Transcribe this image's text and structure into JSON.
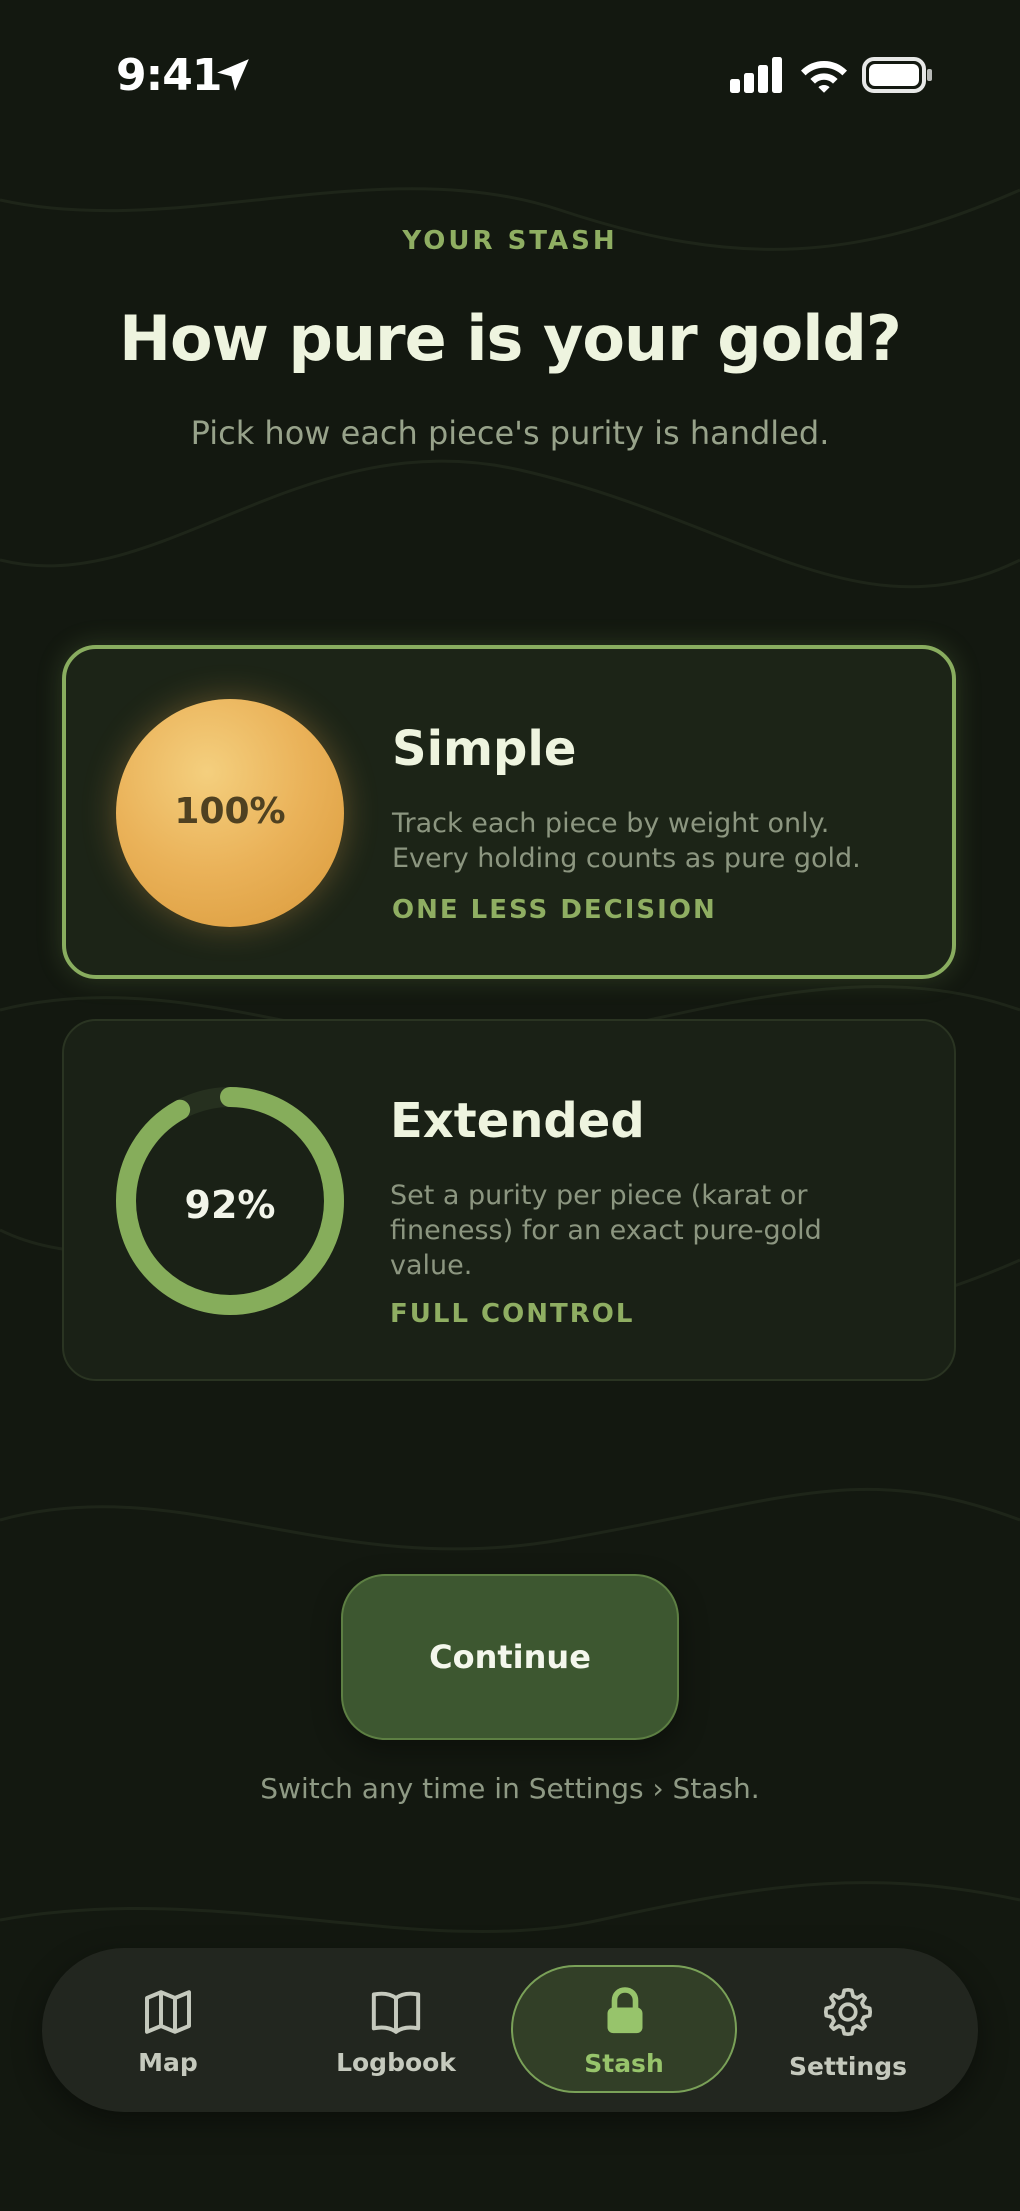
{
  "status_bar": {
    "time": "9:41"
  },
  "header": {
    "eyebrow": "YOUR STASH",
    "title": "How pure is your gold?",
    "subtitle": "Pick how each piece's purity is handled."
  },
  "options": [
    {
      "badge": "100%",
      "title": "Simple",
      "description": "Track each piece by weight only. Every holding counts as pure gold.",
      "tag": "ONE LESS DECISION",
      "selected": true
    },
    {
      "badge": "92%",
      "title": "Extended",
      "description": "Set a purity per piece (karat or fineness) for an exact pure-gold value.",
      "tag": "FULL CONTROL",
      "selected": false,
      "ring_fraction": 0.92
    }
  ],
  "continue_label": "Continue",
  "hint": "Switch any time in Settings › Stash.",
  "tabbar": {
    "items": [
      {
        "label": "Map",
        "icon": "map-icon"
      },
      {
        "label": "Logbook",
        "icon": "book-icon"
      },
      {
        "label": "Stash",
        "icon": "lock-icon",
        "active": true
      },
      {
        "label": "Settings",
        "icon": "gear-icon"
      }
    ]
  },
  "colors": {
    "background": "#131810",
    "accent": "#8fae62",
    "gold": "#eab259",
    "button": "#3d5730"
  }
}
